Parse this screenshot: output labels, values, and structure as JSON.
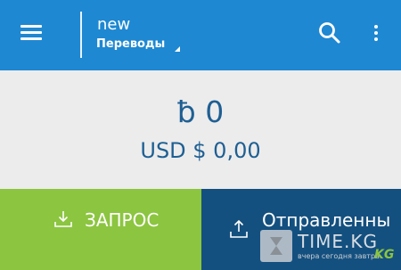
{
  "app_bar": {
    "account_name": "new",
    "section_label": "Переводы",
    "menu_icon": "hamburger-icon",
    "search_icon": "search-icon",
    "more_icon": "more-vert-icon",
    "color": "#1e88d2"
  },
  "balance": {
    "crypto": "ƀ 0",
    "fiat": "USD $ 0,00",
    "color": "#1e5f93"
  },
  "actions": {
    "request_label": "ЗАПРОС",
    "request_color": "#8cc540",
    "send_label": "Отправленны",
    "send_color": "#14507f"
  },
  "watermark": {
    "title": "TIME.KG",
    "subtitle": "вчера сегодня завтра",
    "suffix": "KG"
  }
}
